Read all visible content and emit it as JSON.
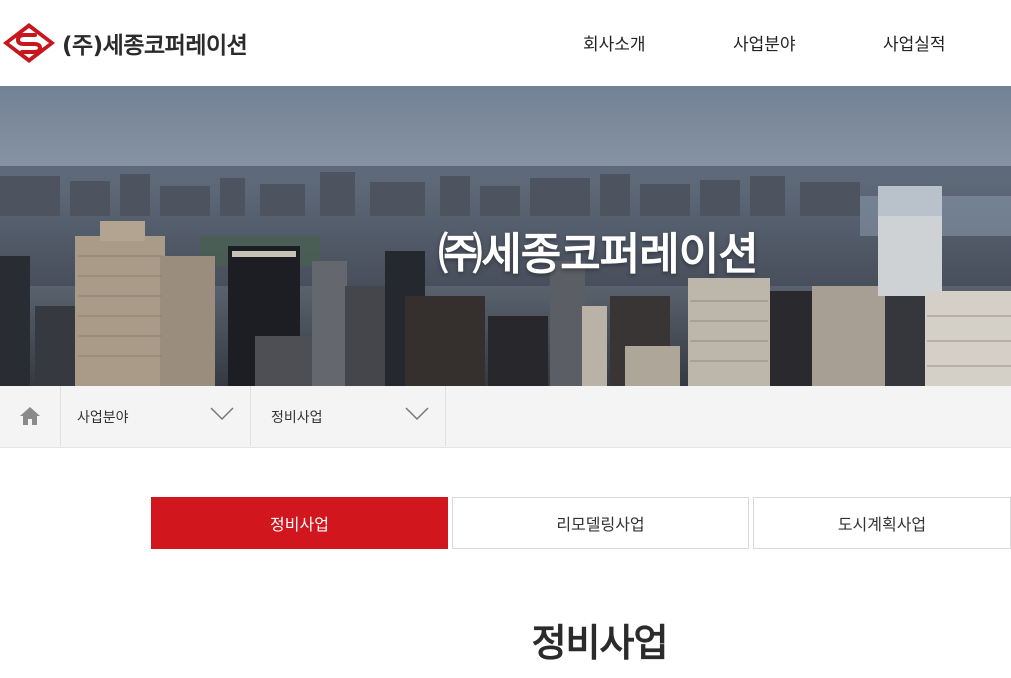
{
  "brand": {
    "name": "(주)세종코퍼레이션",
    "accent": "#d2161e"
  },
  "nav": {
    "items": [
      {
        "label": "회사소개"
      },
      {
        "label": "사업분야"
      },
      {
        "label": "사업실적"
      }
    ]
  },
  "hero": {
    "title": "㈜세종코퍼레이션"
  },
  "breadcrumb": {
    "home_icon": "home-icon",
    "level1": "사업분야",
    "level2": "정비사업",
    "chevron_icon": "chevron-down-icon"
  },
  "tabs": [
    {
      "label": "정비사업",
      "active": true
    },
    {
      "label": "리모델링사업",
      "active": false
    },
    {
      "label": "도시계획사업",
      "active": false
    }
  ],
  "main": {
    "title": "정비사업"
  }
}
